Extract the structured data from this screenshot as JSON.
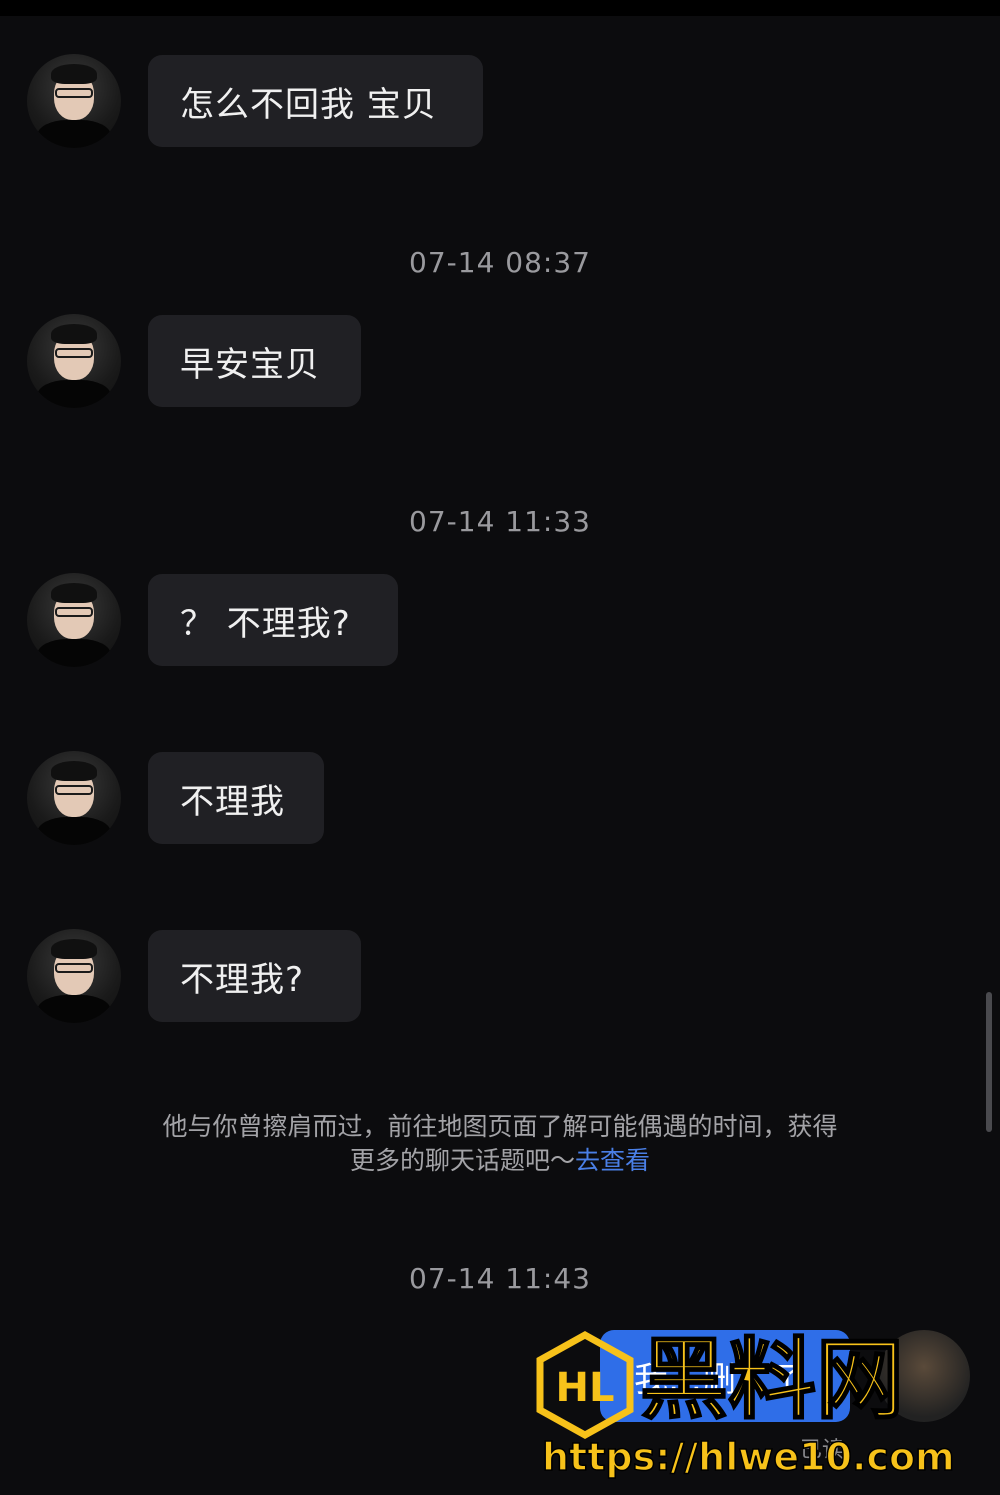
{
  "messages": [
    {
      "text": "怎么不回我 宝贝"
    },
    {
      "text": "早安宝贝"
    },
    {
      "text": "？ 不理我?"
    },
    {
      "text": "不理我"
    },
    {
      "text": "不理我?"
    }
  ],
  "timestamps": [
    "07-14 08:37",
    "07-14 11:33",
    "07-14 11:43"
  ],
  "system_note": {
    "line1": "他与你曾擦肩而过，前往地图页面了解可能偶遇的时间，获得",
    "line2": "更多的聊天话题吧～",
    "link": "去查看"
  },
  "outgoing": {
    "text": "我…删…了",
    "status": "已读"
  },
  "watermark": {
    "brand": "黑料网",
    "url": "https://hlwe10.com",
    "logo_letters": "HL"
  },
  "colors": {
    "background": "#0c0c0e",
    "bubble": "#202024",
    "link": "#4a7fe6",
    "outgoing_bubble": "#2f6ee8",
    "watermark": "#f7c21a"
  }
}
